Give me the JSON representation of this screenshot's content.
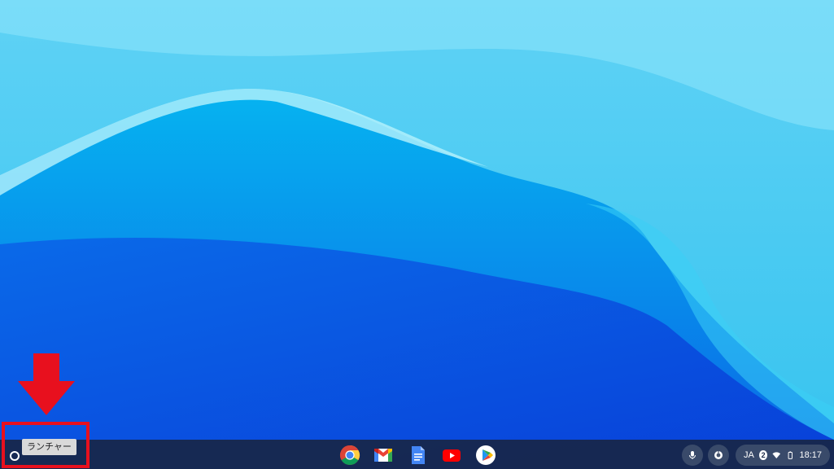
{
  "tooltip": {
    "launcher": "ランチャー"
  },
  "shelf": {
    "apps": [
      "Chrome",
      "Gmail",
      "Docs",
      "YouTube",
      "Play Store"
    ]
  },
  "status": {
    "ime": "JA",
    "notification_count": "2",
    "time": "18:17"
  },
  "colors": {
    "highlight": "#e8101e",
    "shelf": "#182646"
  },
  "icons": [
    "launcher-icon",
    "chrome-icon",
    "gmail-icon",
    "docs-icon",
    "youtube-icon",
    "play-store-icon",
    "microphone-icon",
    "accessibility-icon",
    "wifi-icon",
    "battery-icon",
    "down-arrow-icon"
  ]
}
